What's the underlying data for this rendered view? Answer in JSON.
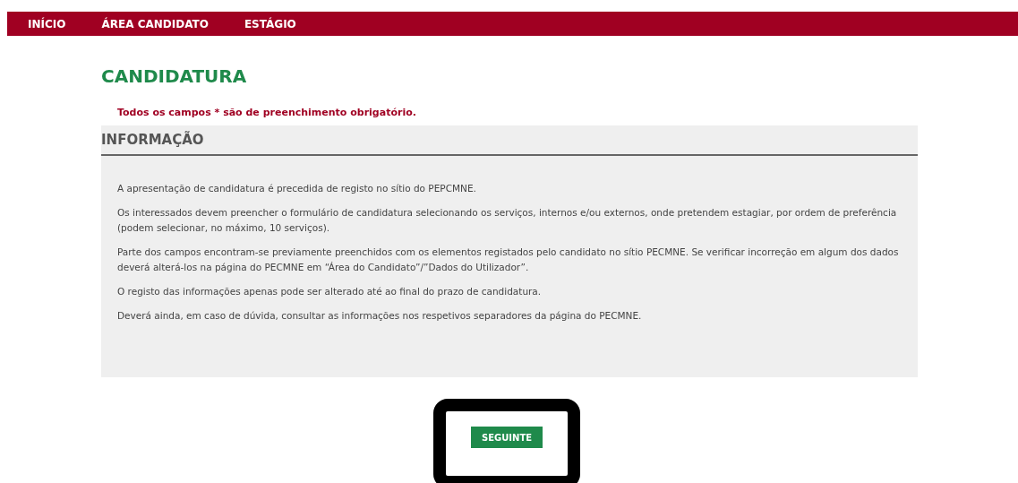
{
  "nav": {
    "items": [
      {
        "label": "INÍCIO"
      },
      {
        "label": "ÁREA CANDIDATO"
      },
      {
        "label": "ESTÁGIO"
      }
    ]
  },
  "title": "CANDIDATURA",
  "required_note": "Todos os campos * são de preenchimento obrigatório.",
  "section": {
    "heading": "INFORMAÇÃO",
    "paragraphs": [
      "A apresentação de candidatura é precedida de registo no sítio do PEPCMNE.",
      "Os interessados devem preencher o formulário de candidatura selecionando os serviços, internos e/ou externos, onde pretendem estagiar, por ordem de preferência (podem selecionar, no máximo, 10 serviços).",
      "Parte dos campos encontram-se previamente preenchidos com os elementos registados pelo candidato no sítio PECMNE. Se verificar incorreção em algum dos dados deverá alterá-los na página do PECMNE em “Área do Candidato”/”Dados do Utilizador”.",
      "O registo das informações apenas pode ser alterado até ao final do prazo de candidatura.",
      "Deverá ainda, em caso de dúvida, consultar as informações nos respetivos separadores da página do PECMNE."
    ]
  },
  "next_button": {
    "label": "SEGUINTE"
  }
}
